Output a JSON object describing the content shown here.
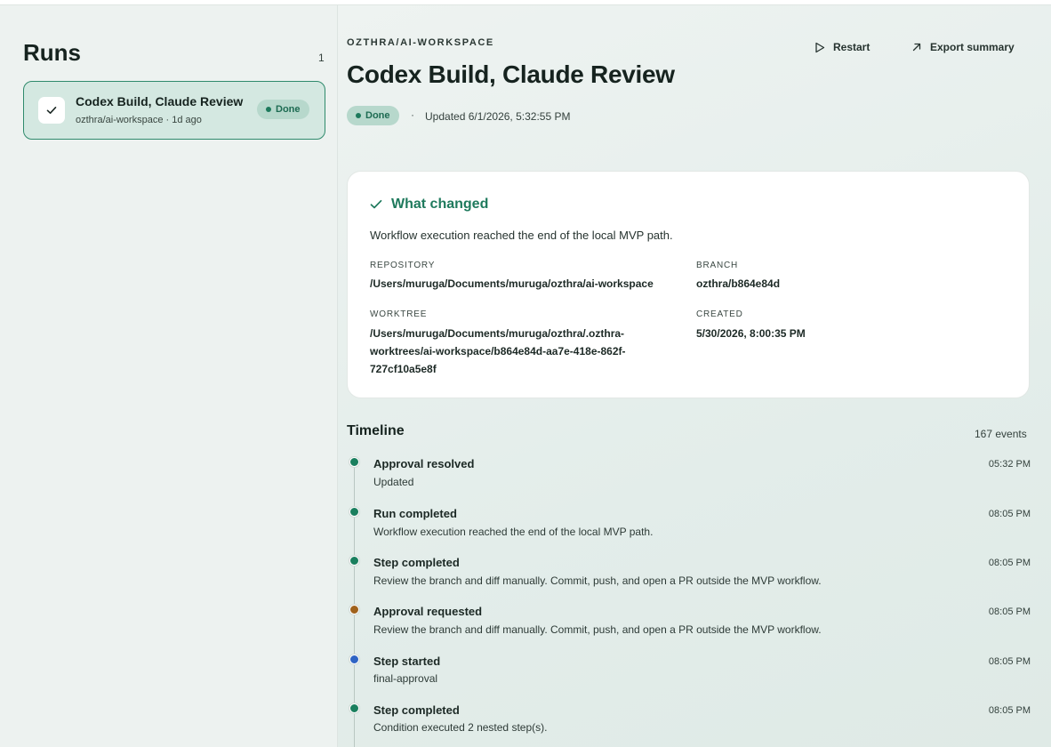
{
  "sidebar": {
    "title": "Runs",
    "count": "1",
    "runs": [
      {
        "name": "Codex Build, Claude Review",
        "meta": "ozthra/ai-workspace · 1d ago",
        "status": "Done"
      }
    ]
  },
  "header": {
    "breadcrumb": "OZTHRA/AI-WORKSPACE",
    "title": "Codex Build, Claude Review",
    "status": "Done",
    "separator": "·",
    "updated": "Updated 6/1/2026, 5:32:55 PM",
    "actions": {
      "restart": "Restart",
      "export": "Export summary"
    }
  },
  "summary": {
    "title": "What changed",
    "description": "Workflow execution reached the end of the local MVP path.",
    "repository_label": "REPOSITORY",
    "repository": "/Users/muruga/Documents/muruga/ozthra/ai-workspace",
    "branch_label": "BRANCH",
    "branch": "ozthra/b864e84d",
    "worktree_label": "WORKTREE",
    "worktree_lines": [
      "/Users/muruga/Documents/muruga/ozthra/.ozthra-",
      "worktrees/ai-workspace/b864e84d-aa7e-418e-862f-",
      "727cf10a5e8f"
    ],
    "created_label": "CREATED",
    "created": "5/30/2026, 8:00:35 PM"
  },
  "timeline": {
    "title": "Timeline",
    "count": "167 events",
    "events": [
      {
        "title": "Approval resolved",
        "desc": "Updated",
        "time": "05:32 PM",
        "color": "#1a7f5e"
      },
      {
        "title": "Run completed",
        "desc": "Workflow execution reached the end of the local MVP path.",
        "time": "08:05 PM",
        "color": "#1a7f5e"
      },
      {
        "title": "Step completed",
        "desc": "Review the branch and diff manually. Commit, push, and open a PR outside the MVP workflow.",
        "time": "08:05 PM",
        "color": "#1a7f5e"
      },
      {
        "title": "Approval requested",
        "desc": "Review the branch and diff manually. Commit, push, and open a PR outside the MVP workflow.",
        "time": "08:05 PM",
        "color": "#a0621c"
      },
      {
        "title": "Step started",
        "desc": "final-approval",
        "time": "08:05 PM",
        "color": "#2f64c4"
      },
      {
        "title": "Step completed",
        "desc": "Condition executed 2 nested step(s).",
        "time": "08:05 PM",
        "color": "#1a7f5e"
      }
    ]
  },
  "colors": {
    "accent": "#1f7a5d",
    "pill_bg": "#b7d8cc",
    "card_selected_bg": "#d4e8e1"
  }
}
